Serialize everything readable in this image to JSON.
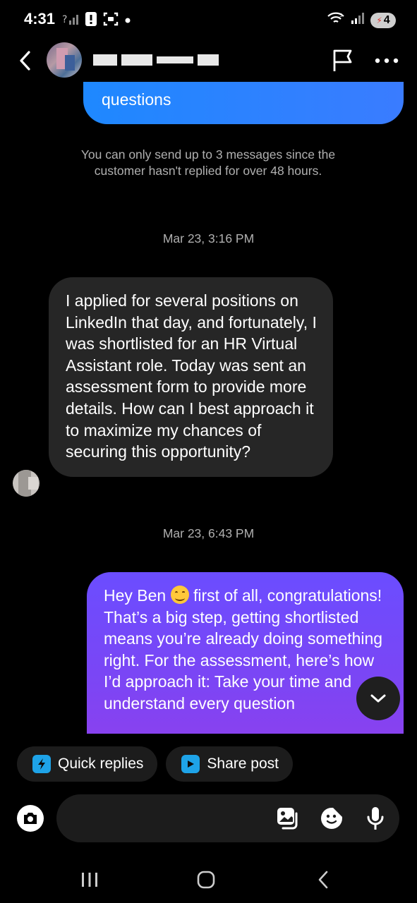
{
  "status_bar": {
    "time": "4:31",
    "battery": "4",
    "icons_left": [
      "signal-question-icon",
      "alert-icon",
      "screenshot-icon",
      "dot-icon"
    ],
    "icons_right": [
      "wifi-icon",
      "cell-signal-icon",
      "battery-icon"
    ]
  },
  "header": {
    "contact_name": "",
    "icons": [
      "back-arrow-icon",
      "flag-icon",
      "more-icon"
    ]
  },
  "chat": {
    "prev_outgoing_tail": "questions",
    "system_note": "You can only send up to 3 messages since the customer hasn't replied for over 48 hours.",
    "timestamp_1": "Mar 23, 3:16 PM",
    "incoming_message": "I applied for several positions on LinkedIn that day, and fortunately, I was shortlisted for an HR Virtual Assistant role. Today was  sent an assessment form to provide more details. How can I best approach it to maximize my chances of securing this opportunity?",
    "timestamp_2": "Mar 23, 6:43 PM",
    "outgoing_message_before_emoji": "Hey Ben",
    "outgoing_message_after_emoji": " first of all, congratulations! That’s a big step, getting shortlisted means you’re already doing something right. For the assessment, here’s how I’d approach it: Take your time and understand every question",
    "emoji": "smiling-face-emoji"
  },
  "quick_actions": {
    "quick_replies_label": "Quick replies",
    "share_post_label": "Share post"
  },
  "composer": {
    "placeholder": "",
    "icons": [
      "camera-icon",
      "gallery-icon",
      "sticker-icon",
      "mic-icon"
    ]
  },
  "colors": {
    "background": "#000000",
    "incoming_bubble": "#262626",
    "outgoing_bubble_top": "#6b4dff",
    "outgoing_bubble_bottom": "#8a41ef",
    "prev_bubble": "#2d84ff",
    "accent_icon": "#1ea3e8",
    "muted_text": "#b0b0b0"
  }
}
